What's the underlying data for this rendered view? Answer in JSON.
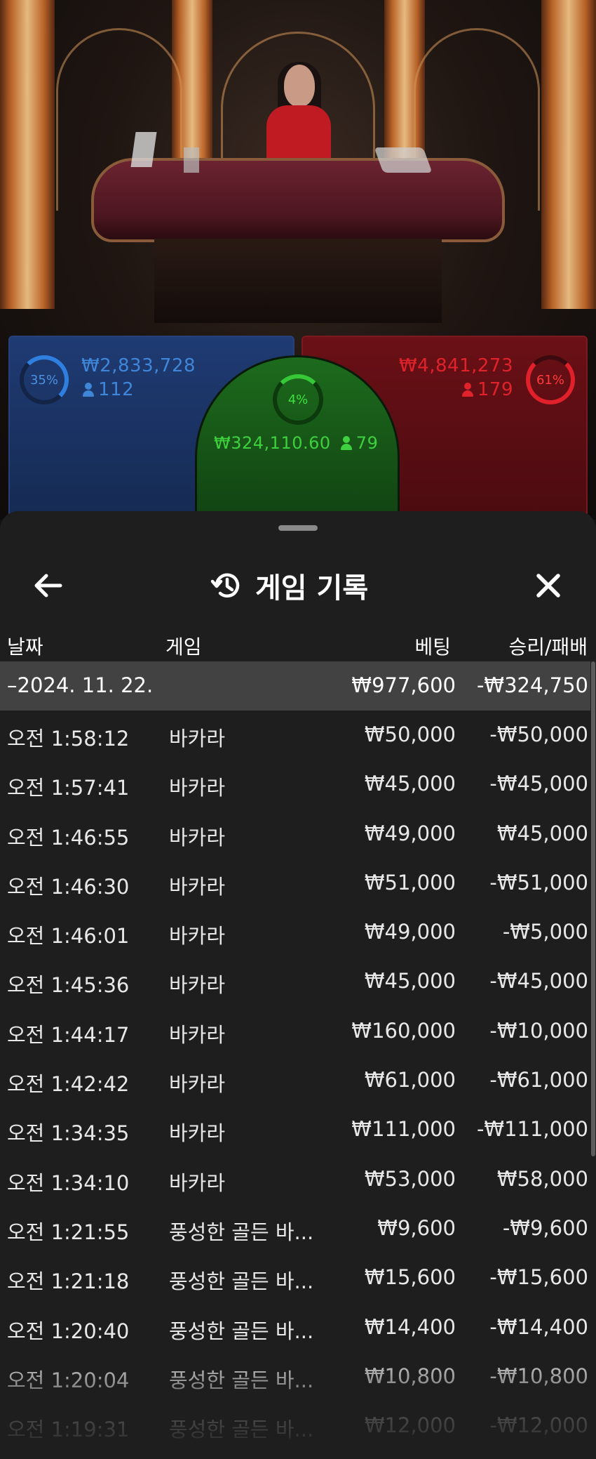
{
  "live": {
    "player": {
      "percent": "35%",
      "amount": "₩2,833,728",
      "players": "112"
    },
    "banker": {
      "percent": "61%",
      "amount": "₩4,841,273",
      "players": "179"
    },
    "tie": {
      "percent": "4%",
      "amount": "₩324,110.60",
      "players": "79"
    },
    "colors": {
      "player": "#2f7fe0",
      "banker": "#e0202a",
      "tie": "#36c836"
    }
  },
  "sheet": {
    "title": "게임 기록",
    "icons": {
      "back": "arrow-left-icon",
      "history": "history-clock-icon",
      "close": "close-icon"
    },
    "columns": {
      "date": "날짜",
      "game": "게임",
      "bet": "베팅",
      "result": "승리/패배"
    },
    "summary": {
      "date": "–2024. 11. 22.",
      "bet": "₩977,600",
      "result": "-₩324,750"
    },
    "rows": [
      {
        "time": "오전 1:58:12",
        "game": "바카라",
        "bet": "₩50,000",
        "result": "-₩50,000"
      },
      {
        "time": "오전 1:57:41",
        "game": "바카라",
        "bet": "₩45,000",
        "result": "-₩45,000"
      },
      {
        "time": "오전 1:46:55",
        "game": "바카라",
        "bet": "₩49,000",
        "result": "₩45,000"
      },
      {
        "time": "오전 1:46:30",
        "game": "바카라",
        "bet": "₩51,000",
        "result": "-₩51,000"
      },
      {
        "time": "오전 1:46:01",
        "game": "바카라",
        "bet": "₩49,000",
        "result": "-₩5,000"
      },
      {
        "time": "오전 1:45:36",
        "game": "바카라",
        "bet": "₩45,000",
        "result": "-₩45,000"
      },
      {
        "time": "오전 1:44:17",
        "game": "바카라",
        "bet": "₩160,000",
        "result": "-₩10,000"
      },
      {
        "time": "오전 1:42:42",
        "game": "바카라",
        "bet": "₩61,000",
        "result": "-₩61,000"
      },
      {
        "time": "오전 1:34:35",
        "game": "바카라",
        "bet": "₩111,000",
        "result": "-₩111,000"
      },
      {
        "time": "오전 1:34:10",
        "game": "바카라",
        "bet": "₩53,000",
        "result": "₩58,000"
      },
      {
        "time": "오전 1:21:55",
        "game": "풍성한 골든 바...",
        "bet": "₩9,600",
        "result": "-₩9,600"
      },
      {
        "time": "오전 1:21:18",
        "game": "풍성한 골든 바...",
        "bet": "₩15,600",
        "result": "-₩15,600"
      },
      {
        "time": "오전 1:20:40",
        "game": "풍성한 골든 바...",
        "bet": "₩14,400",
        "result": "-₩14,400"
      },
      {
        "time": "오전 1:20:04",
        "game": "풍성한 골든 바...",
        "bet": "₩10,800",
        "result": "-₩10,800"
      },
      {
        "time": "오전 1:19:31",
        "game": "풍성한 골든 바...",
        "bet": "₩12,000",
        "result": "-₩12,000"
      }
    ]
  }
}
